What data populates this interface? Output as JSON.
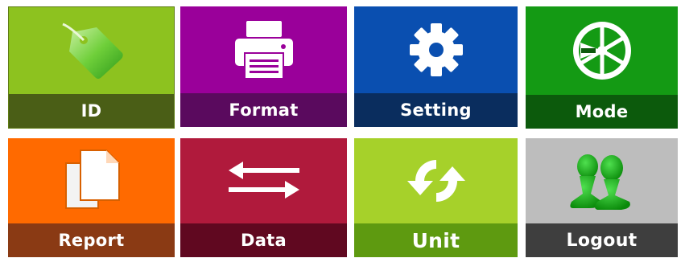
{
  "tiles": [
    {
      "key": "id",
      "label": "ID",
      "icon": "tag-icon",
      "bg": "#8dc21f",
      "bar": "#4a5e16"
    },
    {
      "key": "format",
      "label": "Format",
      "icon": "printer-icon",
      "bg": "#9a009a",
      "bar": "#5a0a5e"
    },
    {
      "key": "setting",
      "label": "Setting",
      "icon": "gear-icon",
      "bg": "#0a4fb0",
      "bar": "#0a2d5e"
    },
    {
      "key": "mode",
      "label": "Mode",
      "icon": "gauge-wheel-icon",
      "bg": "#149a14",
      "bar": "#0c5a0c"
    },
    {
      "key": "report",
      "label": "Report",
      "icon": "documents-icon",
      "bg": "#ff6a00",
      "bar": "#8a3a14"
    },
    {
      "key": "data",
      "label": "Data",
      "icon": "transfer-arrows-icon",
      "bg": "#b01a3c",
      "bar": "#600820"
    },
    {
      "key": "unit",
      "label": "Unit",
      "icon": "refresh-icon",
      "bg": "#a6d12a",
      "bar": "#5e9a10"
    },
    {
      "key": "logout",
      "label": "Logout",
      "icon": "users-icon",
      "bg": "#bdbdbd",
      "bar": "#3e3e3e"
    }
  ]
}
